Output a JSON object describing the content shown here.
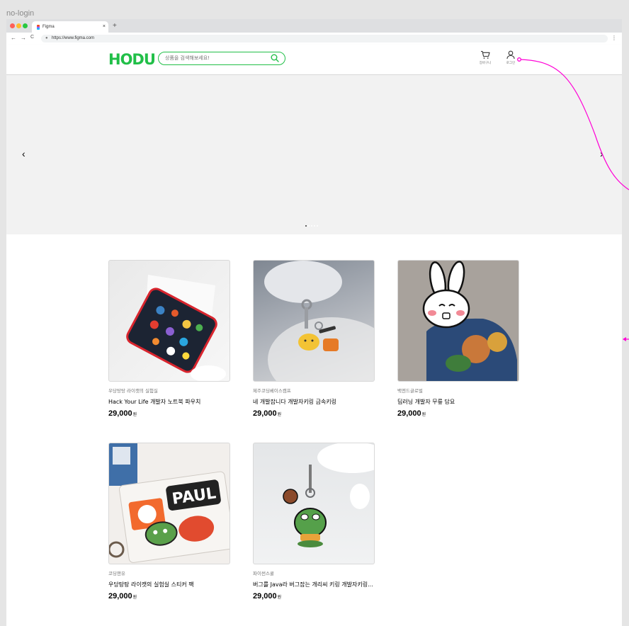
{
  "frame_label": "no-login",
  "browser": {
    "tab_title": "Figma",
    "tab_close": "×",
    "new_tab": "+",
    "back": "←",
    "forward": "→",
    "reload": "C",
    "url": "https://www.figma.com",
    "menu": "⋮"
  },
  "header": {
    "logo": "HODU",
    "search_placeholder": "상품을 검색해보세요!",
    "cart_label": "장바구니",
    "login_label": "로그인"
  },
  "banner": {
    "prev": "‹",
    "next": "›",
    "slide_count": 5,
    "active_slide": 1
  },
  "products": [
    {
      "seller": "우당탕탕 라이캣의 실험실",
      "name": "Hack Your Life 개발자 노트북 파우치",
      "price": "29,000",
      "unit": "원"
    },
    {
      "seller": "제주코딩베이스캠프",
      "name": "네 개발잡니다 개발자키링 금속키링",
      "price": "29,000",
      "unit": "원"
    },
    {
      "seller": "백엔드글로벌",
      "name": "딥러닝 개발자 무릎 담요",
      "price": "29,000",
      "unit": "원"
    },
    {
      "seller": "코딩앤유",
      "name": "우당탕탕 라이캣의 실험실 스티커 팩",
      "price": "29,000",
      "unit": "원"
    },
    {
      "seller": "파이썬스쿨",
      "name": "버그를 Java라 버그잡는 개리씨 키링 개발자키링...",
      "price": "29,000",
      "unit": "원"
    }
  ],
  "colors": {
    "brand": "#21BF48",
    "connector": "#FF00D6"
  }
}
